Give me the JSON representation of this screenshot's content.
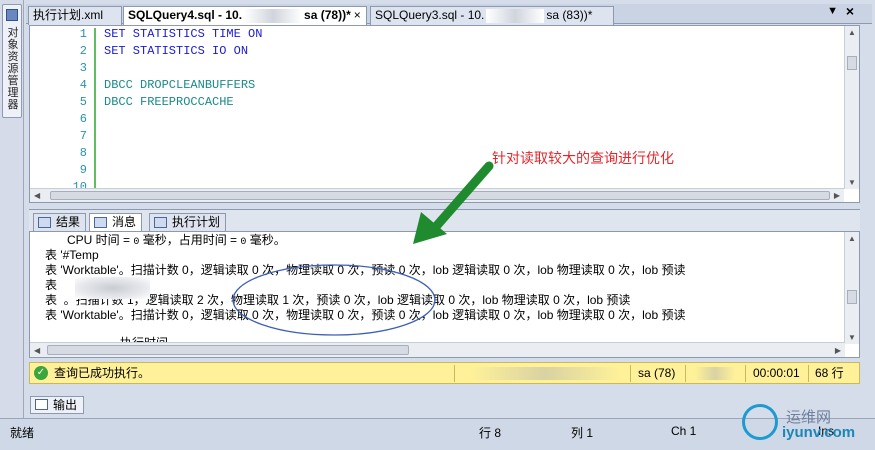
{
  "left_strip": {
    "object_explorer_label": "对象资源管理器",
    "icon": "object-explorer-icon"
  },
  "tabs": [
    {
      "label": "执行计划.xml"
    },
    {
      "label_prefix": "SQLQuery4.sql - 10.",
      "label_suffix": "sa (78))*",
      "close": "×"
    },
    {
      "label_prefix": "SQLQuery3.sql - 10.",
      "label_suffix": "sa (83))*"
    }
  ],
  "tab_bar": {
    "dropdown_icon": "chevron-down-icon",
    "close_icon": "close-icon",
    "dropdown_glyph": "▼",
    "close_glyph": "×"
  },
  "editor": {
    "line_numbers": [
      "1",
      "2",
      "3",
      "4",
      "5",
      "6",
      "7",
      "8",
      "9",
      "10"
    ],
    "lines": [
      "SET STATISTICS TIME ON",
      "SET STATISTICS IO ON",
      "",
      "DBCC DROPCLEANBUFFERS",
      "DBCC FREEPROCCACHE",
      "",
      "",
      "",
      "",
      ""
    ]
  },
  "result_tabs": [
    {
      "label": "结果",
      "icon": "grid-icon"
    },
    {
      "label": "消息",
      "icon": "messages-icon"
    },
    {
      "label": "执行计划",
      "icon": "execution-plan-icon"
    }
  ],
  "messages": [
    {
      "prefix": "CPU 时间 = ",
      "mono": "0",
      "mid": " 毫秒，占用时间 = ",
      "mono2": "0",
      "suffix": " 毫秒。"
    },
    {
      "text": "表 '#Temp"
    },
    {
      "text": "表 'Worktable'。扫描计数 0，逻辑读取 0 次，物理读取 0 次，预读 0 次，lob 逻辑读取 0 次，lob 物理读取 0 次，lob 预读"
    },
    {
      "text": "表"
    },
    {
      "text": "表 ‌        。扫描计数 1，逻辑读取 2 次，物理读取 1 次，预读 0 次，lob 逻辑读取 0 次，lob 物理读取 0 次，lob 预读"
    },
    {
      "text": "表 'Worktable'。扫描计数 0，逻辑读取 0 次，物理读取 0 次，预读 0 次，lob 逻辑读取 0 次，lob 物理读取 0 次，lob 预读"
    },
    {
      "text": ""
    },
    {
      "text": "执行时间"
    }
  ],
  "exec_status": {
    "message": "查询已成功执行。",
    "user": "sa (78)",
    "elapsed": "00:00:01",
    "rows": "68 行"
  },
  "output_tab": {
    "label": "输出"
  },
  "status_bar": {
    "ready": "就绪",
    "row": "行 8",
    "col": "列 1",
    "ch": "Ch 1",
    "mode": "Ins"
  },
  "annotation": {
    "text": "针对读取较大的查询进行优化",
    "color": "#e4262a",
    "arrow_color": "#1f8a2e",
    "ellipse_color": "#3c5fb8"
  },
  "watermark": {
    "line1": "运维网",
    "line2": "iyunv.com"
  },
  "colors": {
    "keyword": "#1a1ad6",
    "function": "#1a8a8a",
    "line_number": "#2b91af",
    "status_yellow": "#fff199"
  }
}
